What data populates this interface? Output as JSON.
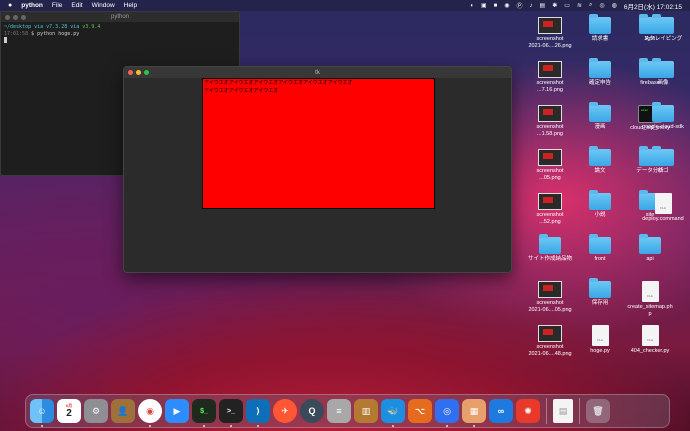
{
  "menubar": {
    "apple": "",
    "items": [
      "python",
      "File",
      "Edit",
      "Window",
      "Help"
    ],
    "clock": "6月2日(水) 17:02:15"
  },
  "terminal": {
    "title": "python",
    "line1_path": "~/desktop via",
    "line1_py": "v7.3.28 via",
    "line1_ver": "v3.9.4",
    "line2_time": "17:01:58",
    "line2_cmd": "$ python hoge.py"
  },
  "tk": {
    "title": "tk",
    "line1": "アイウエオアイウエオアイウエオアイウエオアイウエオアイウエオ",
    "line2": "アイウエオアイウエオアイウエオ",
    "colors": {
      "canvas": "#ff0000"
    }
  },
  "desktop": {
    "icons": [
      {
        "label": "screenshot\n2021-06....26.png",
        "kind": "thumb"
      },
      {
        "label": "請求書",
        "kind": "folder"
      },
      {
        "label": "light",
        "kind": "folder"
      },
      {
        "label": "スクレイピング",
        "kind": "folder"
      },
      {
        "label": "screenshot\n...7.16.png",
        "kind": "thumb"
      },
      {
        "label": "確定申告",
        "kind": "folder"
      },
      {
        "label": "firebase",
        "kind": "folder"
      },
      {
        "label": "画像",
        "kind": "folder"
      },
      {
        "label": "screenshot\n...1.58.png",
        "kind": "thumb"
      },
      {
        "label": "漫画",
        "kind": "folder"
      },
      {
        "label": "cloud_sql_proxy",
        "kind": "exec"
      },
      {
        "label": "google-cloud-sdk",
        "kind": "folder"
      },
      {
        "label": "screenshot\n...05.png",
        "kind": "thumb"
      },
      {
        "label": "論文",
        "kind": "folder"
      },
      {
        "label": "データ分析",
        "kind": "folder"
      },
      {
        "label": "ロゴ",
        "kind": "folder"
      },
      {
        "label": "screenshot\n...52.png",
        "kind": "thumb"
      },
      {
        "label": "小説",
        "kind": "folder"
      },
      {
        "label": "site",
        "kind": "folder"
      },
      {
        "label": "deploy.command",
        "kind": "doc"
      },
      {
        "label": "サイト作成納品物",
        "kind": "folder"
      },
      {
        "label": "front",
        "kind": "folder"
      },
      {
        "label": "api",
        "kind": "folder"
      },
      {
        "label": "screenshot\n2021-06....05.png",
        "kind": "thumb"
      },
      {
        "label": "保存用",
        "kind": "folder"
      },
      {
        "label": "create_sitemap.ph\np",
        "kind": "doc"
      },
      {
        "label": "screenshot\n2021-06....48.png",
        "kind": "thumb"
      },
      {
        "label": "hoge.py",
        "kind": "doc"
      },
      {
        "label": "404_checker.py",
        "kind": "doc"
      }
    ]
  },
  "dock": {
    "calendar_month": "6月",
    "calendar_day": "2"
  }
}
